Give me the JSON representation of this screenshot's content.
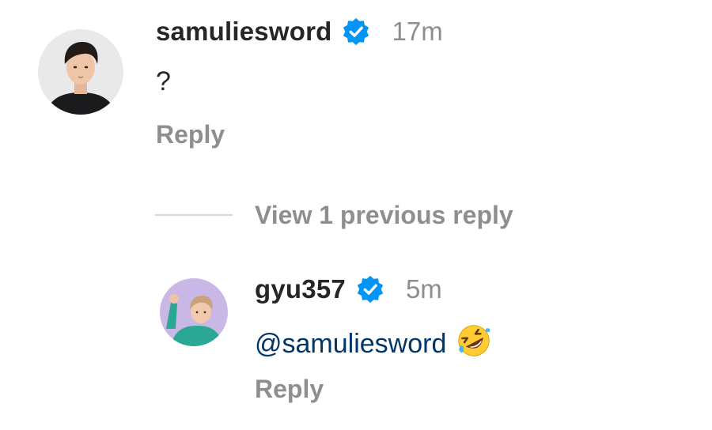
{
  "comments": [
    {
      "username": "samuliesword",
      "verified": true,
      "time": "17m",
      "text": "?",
      "reply_label": "Reply",
      "avatar_icon": "profile-photo-man-black-shirt"
    }
  ],
  "view_replies": {
    "label": "View 1 previous reply"
  },
  "replies": [
    {
      "username": "gyu357",
      "verified": true,
      "time": "5m",
      "mention": "@samuliesword",
      "emoji": "rolling-on-the-floor-laughing-emoji",
      "reply_label": "Reply",
      "avatar_icon": "profile-photo-person-pointing"
    }
  ],
  "colors": {
    "primary_text": "#262626",
    "secondary_text": "#8e8e8e",
    "mention": "#00376b",
    "verified_badge": "#0095f6"
  }
}
